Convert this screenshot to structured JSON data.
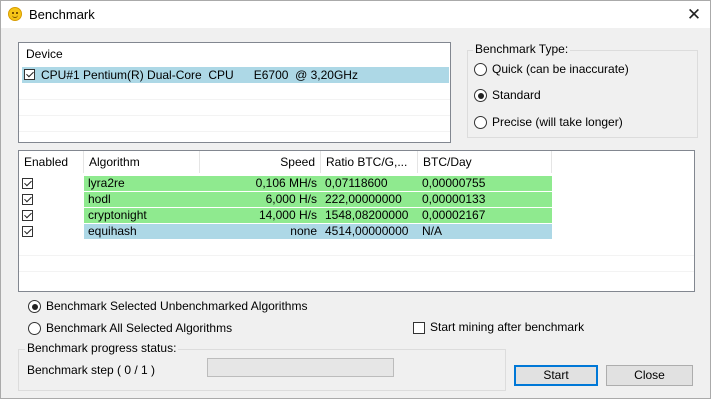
{
  "window": {
    "title": "Benchmark",
    "close_glyph": "✕"
  },
  "device_list": {
    "header": "Device",
    "devices": [
      {
        "name": "CPU#1 Pentium(R) Dual-Core  CPU      E6700  @ 3,20GHz",
        "checked": true
      }
    ]
  },
  "benchmark_type": {
    "legend": "Benchmark Type:",
    "options": [
      {
        "label": "Quick (can be inaccurate)",
        "selected": false
      },
      {
        "label": "Standard",
        "selected": true
      },
      {
        "label": "Precise (will take longer)",
        "selected": false
      }
    ]
  },
  "algorithms": {
    "columns": [
      "Enabled",
      "Algorithm",
      "Speed",
      "Ratio BTC/G,...",
      "BTC/Day"
    ],
    "rows": [
      {
        "enabled": true,
        "algorithm": "lyra2re",
        "speed": "0,106 MH/s",
        "ratio": "0,07118600",
        "btc_day": "0,00000755",
        "color": "#8fea8f"
      },
      {
        "enabled": true,
        "algorithm": "hodl",
        "speed": "6,000 H/s",
        "ratio": "222,00000000",
        "btc_day": "0,00000133",
        "color": "#8fea8f"
      },
      {
        "enabled": true,
        "algorithm": "cryptonight",
        "speed": "14,000 H/s",
        "ratio": "1548,08200000",
        "btc_day": "0,00002167",
        "color": "#8fea8f"
      },
      {
        "enabled": true,
        "algorithm": "equihash",
        "speed": "none",
        "ratio": "4514,00000000",
        "btc_day": "N/A",
        "color": "#add8e6"
      }
    ]
  },
  "mode_options": [
    {
      "label": "Benchmark Selected Unbenchmarked Algorithms",
      "selected": true
    },
    {
      "label": "Benchmark All Selected Algorithms",
      "selected": false
    }
  ],
  "start_mining_after": {
    "label": "Start mining after benchmark",
    "checked": false
  },
  "progress": {
    "legend": "Benchmark progress status:",
    "step_text": "Benchmark step ( 0 / 1 )",
    "fraction": 0
  },
  "buttons": {
    "start": "Start",
    "close": "Close"
  }
}
